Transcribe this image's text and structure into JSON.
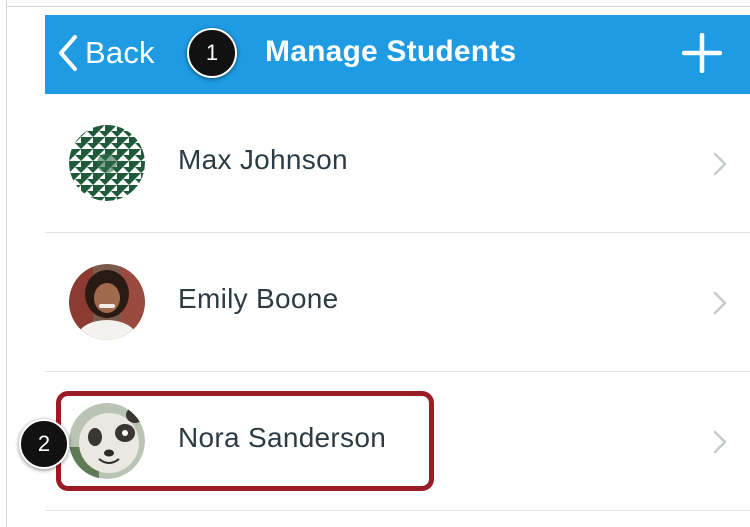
{
  "navbar": {
    "back_label": "Back",
    "title": "Manage Students",
    "accent_color": "#1e9be3"
  },
  "students": [
    {
      "name": "Max Johnson",
      "avatar": "geometric-pattern-avatar"
    },
    {
      "name": "Emily Boone",
      "avatar": "woman-photo-avatar"
    },
    {
      "name": "Nora Sanderson",
      "avatar": "panda-mascot-avatar"
    }
  ],
  "callouts": [
    {
      "number": "1"
    },
    {
      "number": "2"
    }
  ],
  "highlight_color": "#9b1c25"
}
